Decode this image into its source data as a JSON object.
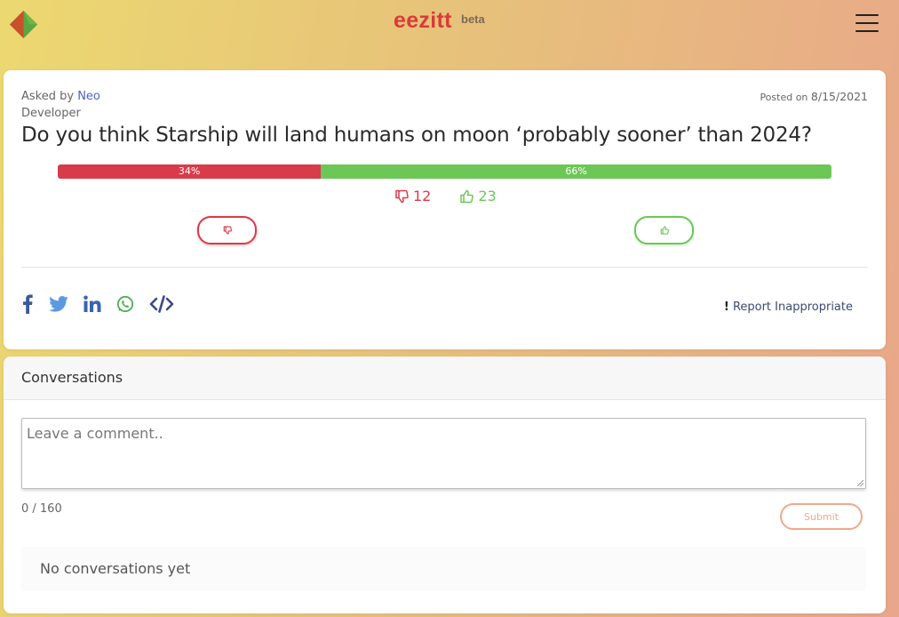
{
  "header": {
    "brand": "eezitt",
    "tag": "beta",
    "logo_icon": "diamond-logo-icon",
    "menu_icon": "hamburger-menu-icon"
  },
  "question": {
    "asked_prefix": "Asked by",
    "author": "Neo",
    "author_role": "Developer",
    "posted_prefix": "Posted on",
    "posted_date": "8/15/2021",
    "text": "Do you think Starship will land humans on moon ‘probably sooner’ than 2024?",
    "poll": {
      "no_percent": 34,
      "yes_percent": 66,
      "no_label": "34%",
      "yes_label": "66%",
      "no_count": "12",
      "yes_count": "23"
    },
    "colors": {
      "no": "#d83b4a",
      "yes": "#6cc757"
    },
    "share_icons": [
      "facebook-icon",
      "twitter-icon",
      "linkedin-icon",
      "whatsapp-icon",
      "embed-code-icon"
    ],
    "report_label": "Report Inappropriate"
  },
  "conversations": {
    "title": "Conversations",
    "placeholder": "Leave a comment..",
    "char_count": "0 / 160",
    "submit_label": "Submit",
    "empty_text": "No conversations yet"
  }
}
